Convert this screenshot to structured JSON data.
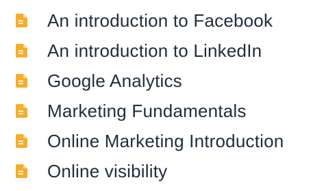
{
  "theme": {
    "icon_color": "#f5ad2a",
    "text_color": "#1f2d3d",
    "background": "#ffffff"
  },
  "course_list": {
    "icon": "document-icon",
    "items": [
      {
        "label": "An introduction to Facebook"
      },
      {
        "label": "An introduction to LinkedIn"
      },
      {
        "label": "Google Analytics"
      },
      {
        "label": "Marketing Fundamentals"
      },
      {
        "label": "Online Marketing Introduction"
      },
      {
        "label": "Online visibility"
      }
    ]
  }
}
